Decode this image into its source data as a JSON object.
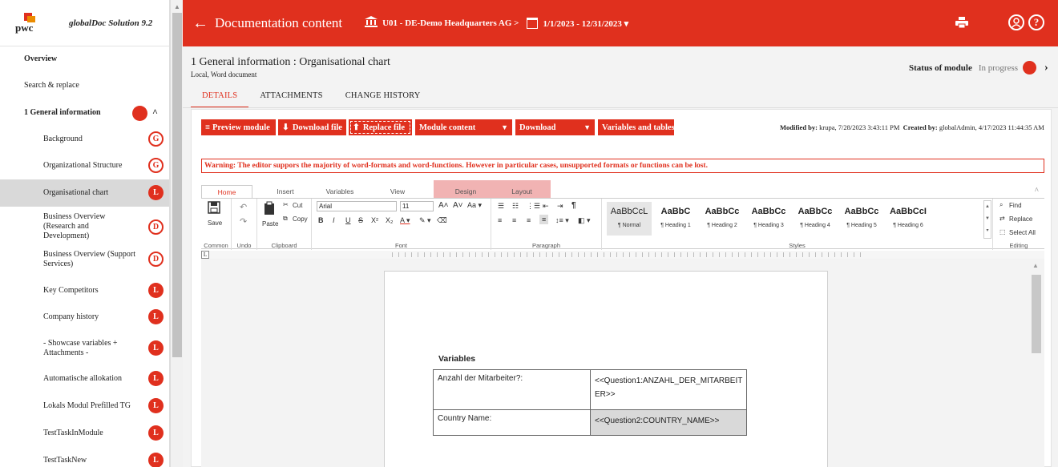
{
  "app": {
    "logo_text": "pwc",
    "name": "globalDoc Solution 9.2"
  },
  "sidebar": {
    "items": [
      {
        "label": "Overview",
        "top": true
      },
      {
        "label": "Search & replace",
        "top": true
      },
      {
        "label": "1 General information",
        "top": true
      },
      {
        "label": "Background",
        "badge": "G"
      },
      {
        "label": "Organizational Structure",
        "badge": "G"
      },
      {
        "label": "Organisational chart",
        "badge": "L"
      },
      {
        "label": "Business Overview (Research and Development)",
        "badge": "D"
      },
      {
        "label": "Business Overview (Support Services)",
        "badge": "D"
      },
      {
        "label": "Key Competitors",
        "badge": "L"
      },
      {
        "label": "Company history",
        "badge": "L"
      },
      {
        "label": "- Showcase variables + Attachments -",
        "badge": "L"
      },
      {
        "label": "Automatische allokation",
        "badge": "L"
      },
      {
        "label": "Lokals Modul Prefilled TG",
        "badge": "L"
      },
      {
        "label": "TestTaskInModule",
        "badge": "L"
      },
      {
        "label": "TestTaskNew",
        "badge": "L"
      }
    ]
  },
  "topbar": {
    "back_arrow": "←",
    "title": "Documentation content",
    "entity": "U01 - DE-Demo Headquarters AG >",
    "period": "1/1/2023 - 12/31/2023 ▾",
    "icons": [
      "bank-icon",
      "calendar-icon",
      "print-icon",
      "user-icon",
      "help-icon"
    ],
    "help_glyph": "?"
  },
  "module": {
    "title": "1 General information : Organisational chart",
    "subtitle": "Local, Word document",
    "status_label": "Status of module",
    "status_value": "In progress",
    "status_chevron": "›"
  },
  "tabs": [
    "DETAILS",
    "ATTACHMENTS",
    "CHANGE HISTORY"
  ],
  "toolbar": {
    "preview": "Preview module",
    "download_file": "Download file",
    "replace_file": "Replace file",
    "module_content": "Module content",
    "download": "Download",
    "variables_tables": "Variables and tables",
    "modified_label": "Modified by:",
    "modified_value": "krupa, 7/28/2023 3:43:11 PM",
    "created_label": "Created by:",
    "created_value": "globalAdmin, 4/17/2023 11:44:35 AM"
  },
  "warning": "Warning: The editor suppors the majority of word-formats and word-functions. However in particular cases, unsupported formats or functions can be lost.",
  "ribbon": {
    "tabs": [
      "Home",
      "Insert",
      "Variables",
      "View",
      "Design",
      "Layout"
    ],
    "groups": {
      "common": "Common",
      "undo": "Undo",
      "clipboard": "Clipboard",
      "font": "Font",
      "paragraph": "Paragraph",
      "styles": "Styles",
      "editing": "Editing"
    },
    "save": "Save",
    "paste": "Paste",
    "cut": "Cut",
    "copy": "Copy",
    "font_name": "Arial",
    "font_size": "11",
    "find": "Find",
    "replace": "Replace",
    "select_all": "Select All",
    "styles": [
      {
        "preview": "AaBbCcL",
        "name": "¶ Normal"
      },
      {
        "preview": "AaBbC",
        "name": "¶ Heading 1"
      },
      {
        "preview": "AaBbCc",
        "name": "¶ Heading 2"
      },
      {
        "preview": "AaBbCc",
        "name": "¶ Heading 3"
      },
      {
        "preview": "AaBbCc",
        "name": "¶ Heading 4"
      },
      {
        "preview": "AaBbCc",
        "name": "¶ Heading 5"
      },
      {
        "preview": "AaBbCcI",
        "name": "¶ Heading 6"
      }
    ]
  },
  "document": {
    "vars_title": "Variables",
    "rows": [
      {
        "key": "Anzahl der Mitarbeiter?:",
        "value": "<<Question1:ANZAHL_DER_MITARBEIT ER>>"
      },
      {
        "key": "Country Name:",
        "value": "<<Question2:COUNTRY_NAME>>"
      }
    ]
  },
  "colors": {
    "accent": "#e0301e",
    "context_tab": "#f1b3b3"
  }
}
